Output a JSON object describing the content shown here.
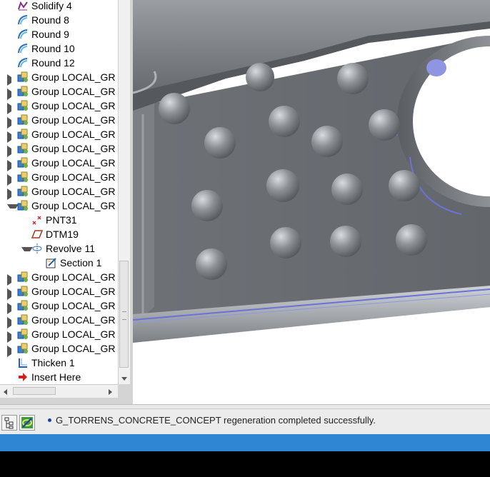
{
  "model_tree": {
    "items": [
      {
        "label": "Solidify 4",
        "icon": "solidify-icon",
        "indent": 1,
        "expander": "none"
      },
      {
        "label": "Round 8",
        "icon": "round-icon",
        "indent": 1,
        "expander": "none"
      },
      {
        "label": "Round 9",
        "icon": "round-icon",
        "indent": 1,
        "expander": "none"
      },
      {
        "label": "Round 10",
        "icon": "round-icon",
        "indent": 1,
        "expander": "none"
      },
      {
        "label": "Round 12",
        "icon": "round-icon",
        "indent": 1,
        "expander": "none"
      },
      {
        "label": "Group LOCAL_GR",
        "icon": "group-icon",
        "indent": 1,
        "expander": "collapsed"
      },
      {
        "label": "Group LOCAL_GR",
        "icon": "group-icon",
        "indent": 1,
        "expander": "collapsed"
      },
      {
        "label": "Group LOCAL_GR",
        "icon": "group-icon",
        "indent": 1,
        "expander": "collapsed"
      },
      {
        "label": "Group LOCAL_GR",
        "icon": "group-icon",
        "indent": 1,
        "expander": "collapsed"
      },
      {
        "label": "Group LOCAL_GR",
        "icon": "group-icon",
        "indent": 1,
        "expander": "collapsed"
      },
      {
        "label": "Group LOCAL_GR",
        "icon": "group-icon",
        "indent": 1,
        "expander": "collapsed"
      },
      {
        "label": "Group LOCAL_GR",
        "icon": "group-icon",
        "indent": 1,
        "expander": "collapsed"
      },
      {
        "label": "Group LOCAL_GR",
        "icon": "group-icon",
        "indent": 1,
        "expander": "collapsed"
      },
      {
        "label": "Group LOCAL_GR",
        "icon": "group-icon",
        "indent": 1,
        "expander": "collapsed"
      },
      {
        "label": "Group LOCAL_GR",
        "icon": "group-icon",
        "indent": 1,
        "expander": "expanded"
      },
      {
        "label": "PNT31",
        "icon": "datum-point-icon",
        "indent": 2,
        "expander": "none"
      },
      {
        "label": "DTM19",
        "icon": "datum-plane-icon",
        "indent": 2,
        "expander": "none"
      },
      {
        "label": "Revolve 11",
        "icon": "revolve-icon",
        "indent": 2,
        "expander": "expanded"
      },
      {
        "label": "Section 1",
        "icon": "sketch-icon",
        "indent": 3,
        "expander": "none"
      },
      {
        "label": "Group LOCAL_GR",
        "icon": "group-icon",
        "indent": 1,
        "expander": "collapsed"
      },
      {
        "label": "Group LOCAL_GR",
        "icon": "group-icon",
        "indent": 1,
        "expander": "collapsed"
      },
      {
        "label": "Group LOCAL_GR",
        "icon": "group-icon",
        "indent": 1,
        "expander": "collapsed"
      },
      {
        "label": "Group LOCAL_GR",
        "icon": "group-icon",
        "indent": 1,
        "expander": "collapsed"
      },
      {
        "label": "Group LOCAL_GR",
        "icon": "group-icon",
        "indent": 1,
        "expander": "collapsed"
      },
      {
        "label": "Group LOCAL_GR",
        "icon": "group-icon",
        "indent": 1,
        "expander": "collapsed"
      },
      {
        "label": "Thicken 1",
        "icon": "thicken-icon",
        "indent": 1,
        "expander": "none"
      },
      {
        "label": "Insert Here",
        "icon": "insert-arrow-icon",
        "indent": 1,
        "expander": "none"
      }
    ]
  },
  "status": {
    "message": "G_TORRENS_CONCRETE_CONCEPT regeneration completed successfully."
  },
  "colors": {
    "model_gray": "#6f7378",
    "highlight_blue": "#6a72d8",
    "taskbar_blue": "#2f86d2"
  }
}
